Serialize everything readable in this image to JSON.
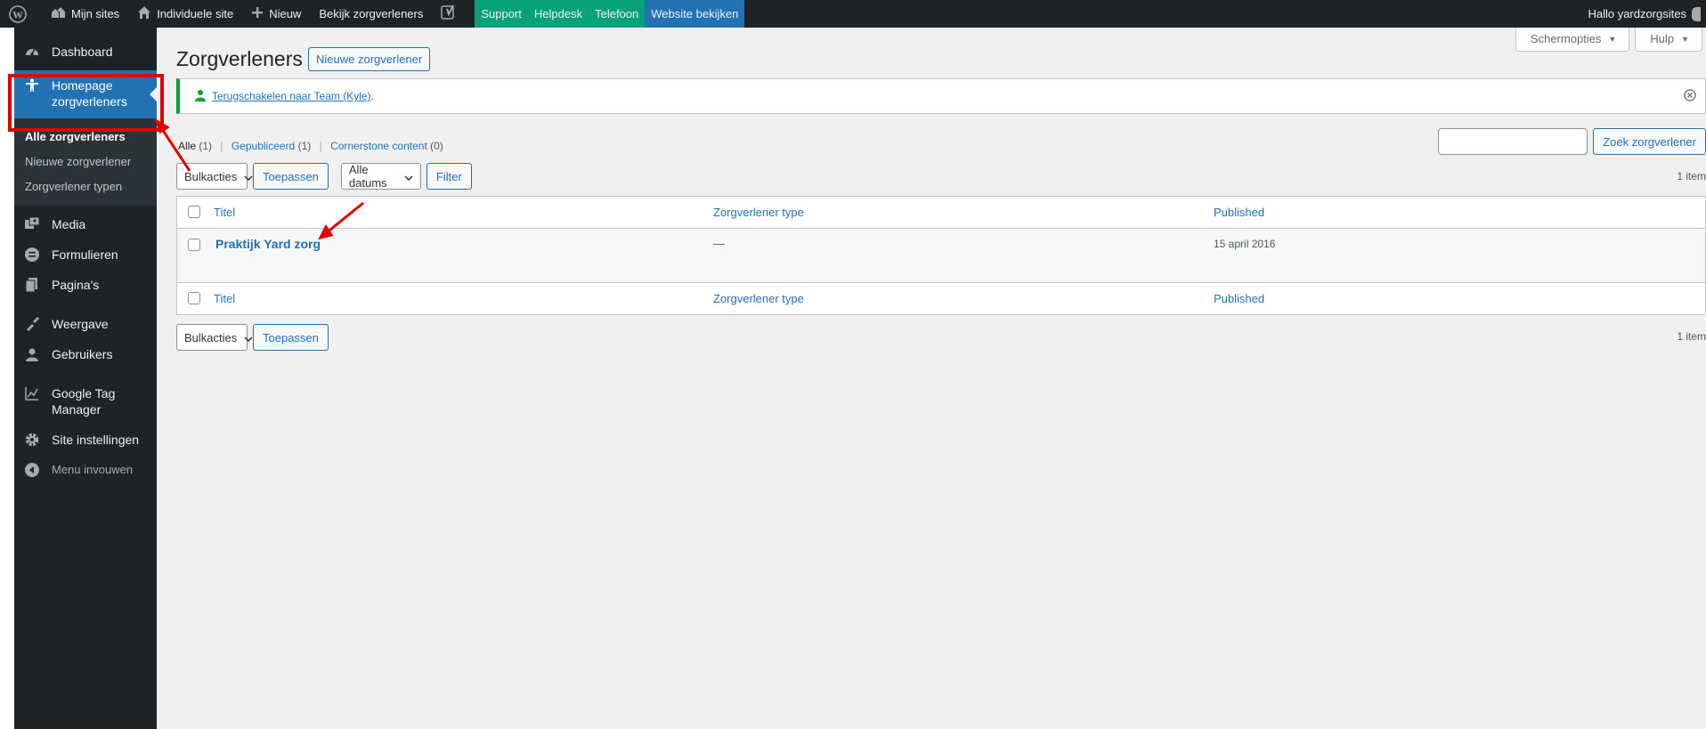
{
  "adminbar": {
    "my_sites": "Mijn sites",
    "individual_site": "Individuele site",
    "new": "Nieuw",
    "view_providers": "Bekijk zorgverleners",
    "support": "Support",
    "helpdesk": "Helpdesk",
    "phone": "Telefoon",
    "view_site": "Website bekijken",
    "greeting": "Hallo yardzorgsites"
  },
  "sidebar": {
    "items": [
      {
        "label": "Dashboard",
        "icon": "dashboard-icon"
      },
      {
        "label": "Homepage zorgverleners",
        "icon": "person-icon"
      },
      {
        "label": "Media",
        "icon": "media-icon"
      },
      {
        "label": "Formulieren",
        "icon": "forms-icon"
      },
      {
        "label": "Pagina's",
        "icon": "pages-icon"
      },
      {
        "label": "Weergave",
        "icon": "appearance-icon"
      },
      {
        "label": "Gebruikers",
        "icon": "users-icon"
      },
      {
        "label": "Google Tag Manager",
        "icon": "chart-line-icon"
      },
      {
        "label": "Site instellingen",
        "icon": "gear-icon"
      },
      {
        "label": "Menu invouwen",
        "icon": "collapse-icon"
      }
    ],
    "submenu": [
      "Alle zorgverleners",
      "Nieuwe zorgverlener",
      "Zorgverlener typen"
    ]
  },
  "screen_meta": {
    "options": "Schermopties",
    "help": "Hulp"
  },
  "page": {
    "title": "Zorgverleners",
    "add_new": "Nieuwe zorgverlener"
  },
  "notice": {
    "link": "Terugschakelen naar Team (Kyle)",
    "suffix": "."
  },
  "views": {
    "all": "Alle",
    "all_count": "(1)",
    "published": "Gepubliceerd",
    "published_count": "(1)",
    "cornerstone": "Cornerstone content",
    "cornerstone_count": "(0)"
  },
  "search": {
    "value": "",
    "button": "Zoek zorgverlener"
  },
  "tablenav": {
    "bulk_actions": "Bulkacties",
    "apply": "Toepassen",
    "all_dates": "Alle datums",
    "filter": "Filter",
    "items_count": "1 item"
  },
  "table": {
    "columns": [
      "Titel",
      "Zorgverlener type",
      "Published"
    ],
    "rows": [
      {
        "title": "Praktijk Yard zorg",
        "type": "—",
        "published": "15 april 2016"
      }
    ]
  },
  "colors": {
    "admin_dark": "#1d2327",
    "accent_blue": "#2271b1",
    "green_menu": "#07a17c",
    "annotation_red": "#e00000"
  }
}
